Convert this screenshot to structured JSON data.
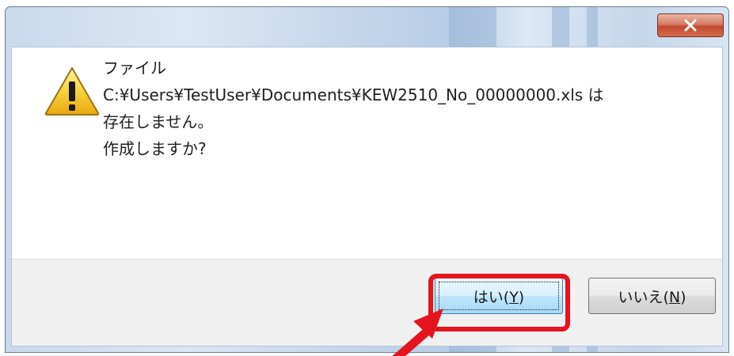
{
  "dialog": {
    "message_lines": [
      "ファイル",
      "C:¥Users¥TestUser¥Documents¥KEW2510_No_00000000.xls は",
      "存在しません。",
      "作成しますか?"
    ],
    "icon": "warning-icon"
  },
  "buttons": {
    "yes_label": "はい(",
    "yes_key": "Y",
    "yes_suffix": ")",
    "no_label": "いいえ(",
    "no_key": "N",
    "no_suffix": ")"
  },
  "titlebar": {
    "close_icon": "close-icon"
  },
  "annotation": {
    "highlight_color": "#e5141e",
    "arrow_color": "#e5141e"
  }
}
